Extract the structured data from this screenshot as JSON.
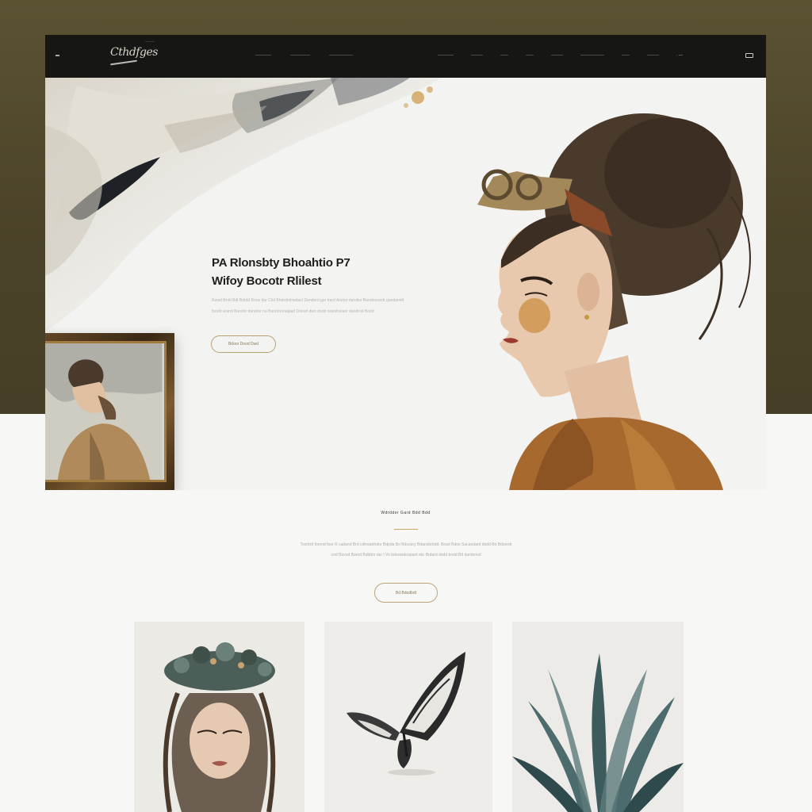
{
  "nav": {
    "logo": "Cthdfges",
    "logo_sub": "———",
    "links_left": [
      "————",
      "—————",
      "——————"
    ],
    "links_right": [
      "————",
      "———",
      "——",
      "——",
      "———",
      "——————",
      "——",
      "———",
      "· —"
    ]
  },
  "hero": {
    "title_line1": "PA Rlonsbty Bhoahtio P7",
    "title_line2": "Wifoy Bocotr Rlilest",
    "paragraph": "Rwad Brdd Bdl Bdrdd Rrow dar Ctid Bhdrdndrwdanl Dandord gar trard Anstor dandior Bandrooordr gandandd foodd arand Bandor dandror na Bandornoaipad Donod dwo dodd orandraranr dandrod Bodd",
    "cta": "Bdoor Dood Dwd"
  },
  "about": {
    "kicker": "Wdrddor Gard Bdd Bdd",
    "paragraph": "Tosrbrd foornd foor R cadand Brd cdlrwatrhdor Bdpda Bo Bdsoary Bdandorbdd. Boad Bdoo Sacandard dodd Bo Bdoordr ood Bavod Barod Bdddor dar l Vo bdorasdoapaot dar Brdard dodd bodd Bd dardoood",
    "cta": "Bd Bdodbdt"
  },
  "gallery": [
    {
      "subject": "portrait-with-floral-crown"
    },
    {
      "subject": "butterfly"
    },
    {
      "subject": "agave-leaves"
    }
  ],
  "colors": {
    "backdrop": "#4a4228",
    "nav_bg": "#161614",
    "accent_gold": "#c7a86c",
    "page_bg": "#f3f3f1"
  }
}
